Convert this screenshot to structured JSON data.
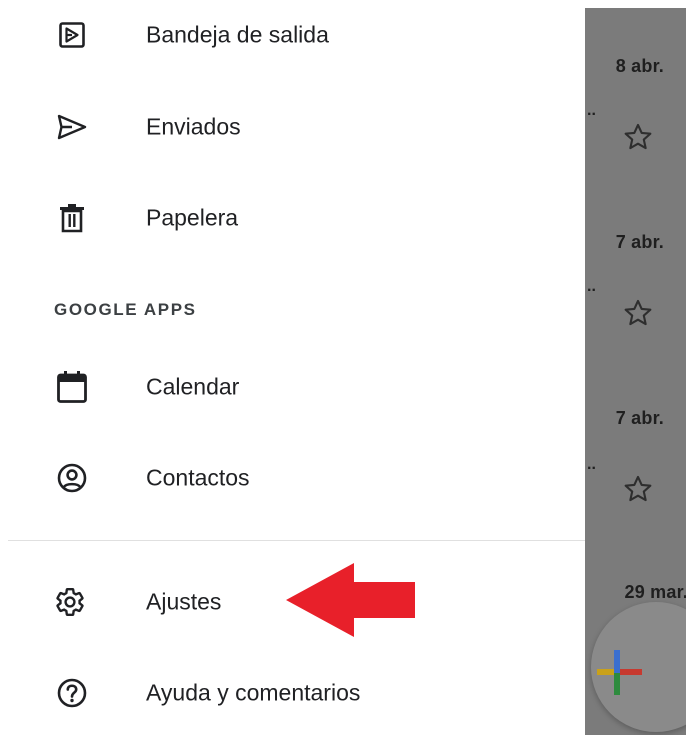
{
  "drawer": {
    "items_top": [
      {
        "label": "Bandeja de salida",
        "icon": "outbox-icon"
      },
      {
        "label": "Enviados",
        "icon": "send-icon"
      },
      {
        "label": "Papelera",
        "icon": "trash-icon"
      }
    ],
    "section_header": "GOOGLE APPS",
    "items_apps": [
      {
        "label": "Calendar",
        "icon": "calendar-icon"
      },
      {
        "label": "Contactos",
        "icon": "contacts-icon"
      }
    ],
    "items_bottom": [
      {
        "label": "Ajustes",
        "icon": "settings-icon"
      },
      {
        "label": "Ayuda y comentarios",
        "icon": "help-icon"
      }
    ]
  },
  "inbox": {
    "dates": [
      "8 abr.",
      "7 abr.",
      "7 abr.",
      "29 mar."
    ],
    "truncation": ".."
  },
  "annotation": {
    "arrow_color": "#e8202a"
  }
}
